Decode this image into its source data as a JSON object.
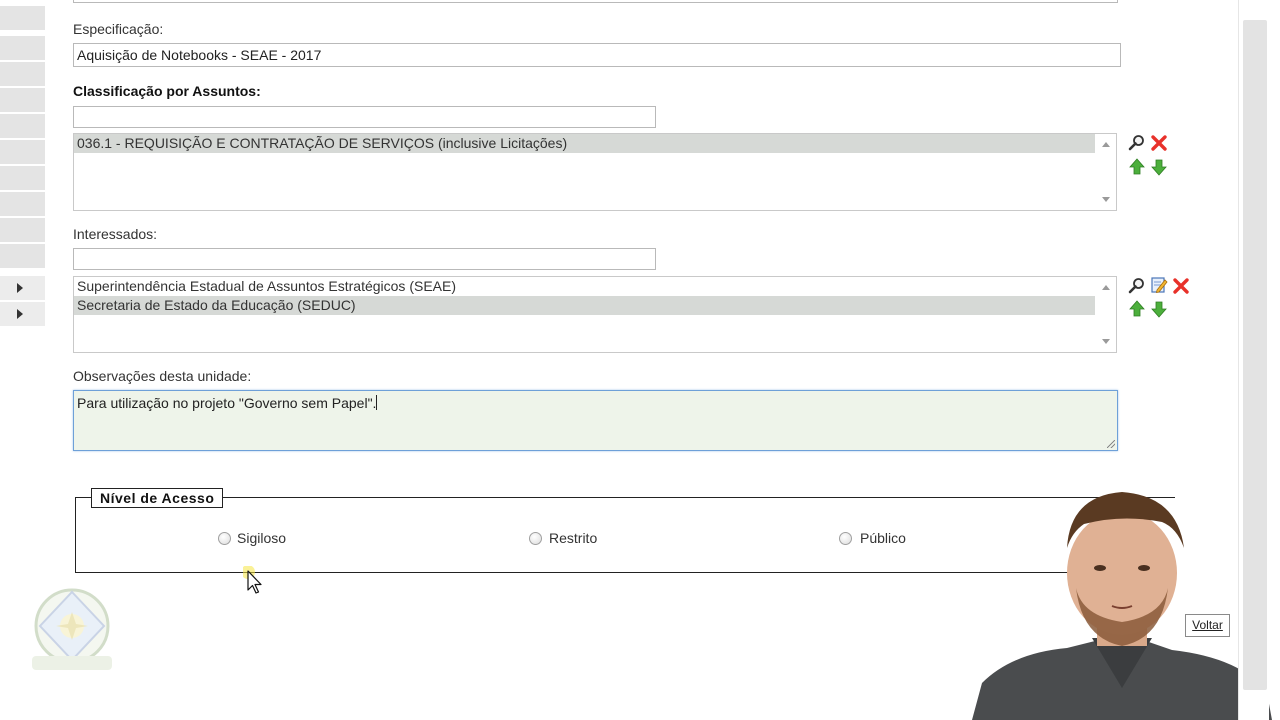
{
  "form": {
    "especificacao_label": "Especificação:",
    "especificacao_value": "Aquisição de Notebooks - SEAE - 2017",
    "classificacao_label": "Classificação por Assuntos:",
    "classificacao_search_value": "",
    "classificacao_items": [
      "036.1 - REQUISIÇÃO E CONTRATAÇÃO DE SERVIÇOS (inclusive Licitações)"
    ],
    "interessados_label": "Interessados:",
    "interessados_search_value": "",
    "interessados_items": [
      "Superintendência Estadual de Assuntos Estratégicos (SEAE)",
      "Secretaria de Estado da Educação (SEDUC)"
    ],
    "observacoes_label": "Observações desta unidade:",
    "observacoes_value": "Para utilização no projeto \"Governo sem Papel\"."
  },
  "nivel_acesso": {
    "legend": "Nível de Acesso",
    "options": [
      "Sigiloso",
      "Restrito",
      "Público"
    ],
    "selected": null
  },
  "buttons": {
    "voltar": "Voltar"
  },
  "icons": {
    "search": "magnifier-icon",
    "remove": "red-x-icon",
    "up": "green-up-arrow-icon",
    "down": "green-down-arrow-icon",
    "edit": "edit-note-icon"
  },
  "colors": {
    "selected_row": "#d6d9d6",
    "textarea_bg": "#eef4ea",
    "remove_red": "#e8312a",
    "arrow_green": "#4caf3c"
  }
}
